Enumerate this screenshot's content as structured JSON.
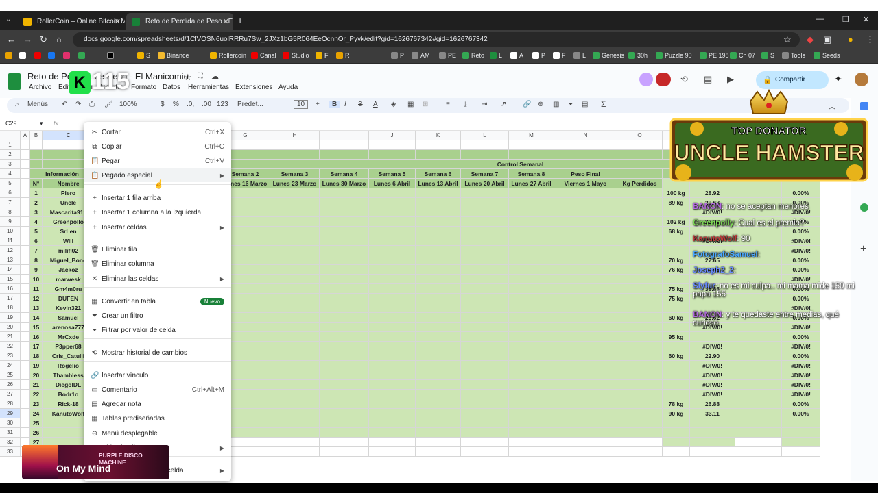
{
  "browser": {
    "tabs": [
      {
        "title": "RollerCoin – Online Bitcoin Mi...",
        "active": false
      },
      {
        "title": "Reto de Perdida de Peso - El M...",
        "active": true
      }
    ],
    "url": "docs.google.com/spreadsheets/d/1ClVQSN6uolRRRu7Sw_2JXz1bG5R064EeOcnnOr_Pyvk/edit?gid=1626767342#gid=1626767342",
    "bookmarks": [
      "",
      "",
      "",
      "",
      "",
      "",
      "",
      "S",
      "Binance",
      "",
      "Rollercoin",
      "Canal",
      "Studio",
      "F",
      "R",
      "",
      "P",
      "AM",
      "PE",
      "Reto",
      "L",
      "A",
      "P",
      "F",
      "L",
      "Genesis",
      "30h",
      "Puzzle 90",
      "PE 198",
      "Ch 07",
      "S",
      "Tools",
      "Seeds"
    ]
  },
  "sheets": {
    "doc_title": "Reto de Perdida de Peso - El Manicomio",
    "menus": [
      "Archivo",
      "Editar",
      "Ver",
      "Insertar",
      "Formato",
      "Datos",
      "Herramientas",
      "Extensiones",
      "Ayuda"
    ],
    "share_label": "Compartir",
    "toolbar": {
      "search": "Menús",
      "zoom": "100%",
      "currency": "$",
      "percent": "%",
      "dec1": ".0,",
      "dec2": ".00",
      "num": "123",
      "font": "Predet...",
      "size": "10",
      "sigma": "Σ"
    },
    "cell_ref": "C29",
    "fx": "fx"
  },
  "grid": {
    "col_headers": [
      "A",
      "B",
      "C",
      "D",
      "E",
      "F",
      "G",
      "H",
      "I",
      "J",
      "K",
      "L",
      "M",
      "N",
      "O",
      "P",
      "Q",
      "R",
      "S"
    ],
    "row_numbers": [
      "1",
      "2",
      "3",
      "4",
      "5",
      "6",
      "7",
      "8",
      "9",
      "10",
      "11",
      "12",
      "13",
      "14",
      "15",
      "16",
      "17",
      "18",
      "19",
      "20",
      "21",
      "22",
      "23",
      "24",
      "25",
      "26",
      "27",
      "28",
      "29",
      "30",
      "31",
      "32",
      "33"
    ],
    "control_title": "Control Semanal",
    "info_header": "Información",
    "week_headers": [
      "Semana 2",
      "Semana 3",
      "Semana 4",
      "Semana 5",
      "Semana 6",
      "Semana 7",
      "Semana 8",
      "Peso Final"
    ],
    "date_headers": [
      "Lunes 16 Marzo",
      "Lunes 23 Marzo",
      "Lunes 30 Marzo",
      "Lunes 6 Abril",
      "Lunes 13 Abril",
      "Lunes 20 Abril",
      "Lunes 27 Abril",
      "Viernes 1 Mayo"
    ],
    "kg_perdidos": "Kg Perdidos",
    "col_n": "N°",
    "col_nombre": "Nombre",
    "participants": [
      {
        "n": "1",
        "name": "Piero",
        "kg": "100 kg",
        "r": "28.92",
        "pct": "0.00%"
      },
      {
        "n": "2",
        "name": "Uncle",
        "kg": "89 kg",
        "r": "29.63",
        "pct": "0.00%"
      },
      {
        "n": "3",
        "name": "Mascarita912",
        "kg": "",
        "r": "#DIV/0!",
        "pct": "#DIV/0!"
      },
      {
        "n": "4",
        "name": "Greenpollo",
        "kg": "102 kg",
        "r": "38.99",
        "pct": "0.00%"
      },
      {
        "n": "5",
        "name": "SrLen",
        "kg": "68 kg",
        "r": "",
        "pct": "0.00%"
      },
      {
        "n": "6",
        "name": "Will",
        "kg": "",
        "r": "#DIV/0!",
        "pct": "#DIV/0!"
      },
      {
        "n": "7",
        "name": "milifl02",
        "kg": "",
        "r": "",
        "pct": "#DIV/0!"
      },
      {
        "n": "8",
        "name": "Miguel_Bono",
        "kg": "70 kg",
        "r": "27.65",
        "pct": "0.00%"
      },
      {
        "n": "9",
        "name": "Jackoz",
        "kg": "76 kg",
        "r": "30.96",
        "pct": "0.00%"
      },
      {
        "n": "10",
        "name": "marwesk",
        "kg": "",
        "r": "",
        "pct": "#DIV/0!"
      },
      {
        "n": "11",
        "name": "Gm4m0ru",
        "kg": "75 kg",
        "r": "38.88",
        "pct": "0.00%"
      },
      {
        "n": "12",
        "name": "DUFEN",
        "kg": "75 kg",
        "r": "",
        "pct": "0.00%"
      },
      {
        "n": "13",
        "name": "Kevin321",
        "kg": "",
        "r": "",
        "pct": "#DIV/0!"
      },
      {
        "n": "14",
        "name": "Samuel",
        "kg": "60 kg",
        "r": "23.62",
        "pct": "0.00%"
      },
      {
        "n": "15",
        "name": "arenosa777",
        "kg": "",
        "r": "#DIV/0!",
        "pct": "#DIV/0!"
      },
      {
        "n": "16",
        "name": "MrCxde",
        "kg": "95 kg",
        "r": "",
        "pct": "0.00%"
      },
      {
        "n": "17",
        "name": "P3pper68",
        "kg": "",
        "r": "#DIV/0!",
        "pct": "#DIV/0!"
      },
      {
        "n": "18",
        "name": "Cris_Catulli",
        "kg": "60 kg",
        "r": "22.90",
        "pct": "0.00%"
      },
      {
        "n": "19",
        "name": "Rogelio",
        "kg": "",
        "r": "#DIV/0!",
        "pct": "#DIV/0!"
      },
      {
        "n": "20",
        "name": "Thambless",
        "kg": "",
        "r": "#DIV/0!",
        "pct": "#DIV/0!"
      },
      {
        "n": "21",
        "name": "DiegoIDL",
        "kg": "",
        "r": "#DIV/0!",
        "pct": "#DIV/0!"
      },
      {
        "n": "22",
        "name": "Bodr1o",
        "kg": "",
        "r": "#DIV/0!",
        "pct": "#DIV/0!"
      },
      {
        "n": "23",
        "name": "Rick-18",
        "kg": "78 kg",
        "r": "26.88",
        "pct": "0.00%"
      },
      {
        "n": "24",
        "name": "KanutoWolf",
        "kg": "90 kg",
        "r": "33.11",
        "pct": "0.00%"
      },
      {
        "n": "25",
        "name": "",
        "kg": "",
        "r": "",
        "pct": ""
      },
      {
        "n": "26",
        "name": "",
        "kg": "",
        "r": "",
        "pct": ""
      },
      {
        "n": "27",
        "name": "",
        "kg": "",
        "r": "",
        "pct": ""
      }
    ]
  },
  "context_menu": {
    "items": [
      {
        "label": "Cortar",
        "shortcut": "Ctrl+X",
        "icon": "scissors-icon"
      },
      {
        "label": "Copiar",
        "shortcut": "Ctrl+C",
        "icon": "copy-icon"
      },
      {
        "label": "Pegar",
        "shortcut": "Ctrl+V",
        "icon": "paste-icon"
      },
      {
        "label": "Pegado especial",
        "shortcut": "",
        "icon": "paste-special-icon"
      },
      {
        "label": "Insertar 1 fila arriba",
        "shortcut": "",
        "icon": "plus-icon"
      },
      {
        "label": "Insertar 1 columna a la izquierda",
        "shortcut": "",
        "icon": "plus-icon"
      },
      {
        "label": "Insertar celdas",
        "shortcut": "",
        "icon": "plus-icon"
      },
      {
        "label": "Eliminar fila",
        "shortcut": "",
        "icon": "trash-icon"
      },
      {
        "label": "Eliminar columna",
        "shortcut": "",
        "icon": "trash-icon"
      },
      {
        "label": "Eliminar las celdas",
        "shortcut": "",
        "icon": "x-icon"
      },
      {
        "label": "Convertir en tabla",
        "shortcut": "",
        "icon": "table-icon"
      },
      {
        "label": "Crear un filtro",
        "shortcut": "",
        "icon": "filter-icon"
      },
      {
        "label": "Filtrar por valor de celda",
        "shortcut": "",
        "icon": "filter-icon"
      },
      {
        "label": "Mostrar historial de cambios",
        "shortcut": "",
        "icon": "history-icon"
      },
      {
        "label": "Insertar vínculo",
        "shortcut": "",
        "icon": "link-icon"
      },
      {
        "label": "Comentario",
        "shortcut": "Ctrl+Alt+M",
        "icon": "comment-icon"
      },
      {
        "label": "Agregar nota",
        "shortcut": "",
        "icon": "note-icon"
      },
      {
        "label": "Tablas prediseñadas",
        "shortcut": "",
        "icon": "table-icon"
      },
      {
        "label": "Menú desplegable",
        "shortcut": "",
        "icon": "dropdown-icon"
      },
      {
        "label": "Chips inteligentes",
        "shortcut": "",
        "icon": "chip-icon"
      },
      {
        "label": "Ver más acciones de celda",
        "shortcut": "",
        "icon": "more-icon"
      }
    ],
    "nuevo_badge": "Nuevo"
  },
  "overlay": {
    "donor_line1": "TOP DONATOR",
    "donor_line2": "UNCLE HAMSTER",
    "k_badge": "115",
    "chat": [
      {
        "user": "BANON",
        "msg": ": no se aceptan menores",
        "color": "#b46ae0"
      },
      {
        "user": "Greenpolly",
        "msg": ": Cual es el premio?",
        "color": "#7ed957"
      },
      {
        "user": "KanutoWolf",
        "msg": ": 90",
        "color": "#c23b3b"
      },
      {
        "user": "FotografoSamuel",
        "msg": ": ",
        "color": "#4aa8ff"
      },
      {
        "user": "Joseph2_2",
        "msg": ": ",
        "color": "#6a8cff"
      },
      {
        "user": "Slyfur",
        "msg": ": no es mi culpa.. mi mama mide 150 mi papa 155",
        "color": "#6a8cff"
      },
      {
        "user": "BANON",
        "msg": ": y te quedaste entre medias, qué curioso",
        "color": "#b46ae0"
      }
    ],
    "music_artist": "PURPLE DISCO MACHINE",
    "music_title": "On My Mind"
  }
}
